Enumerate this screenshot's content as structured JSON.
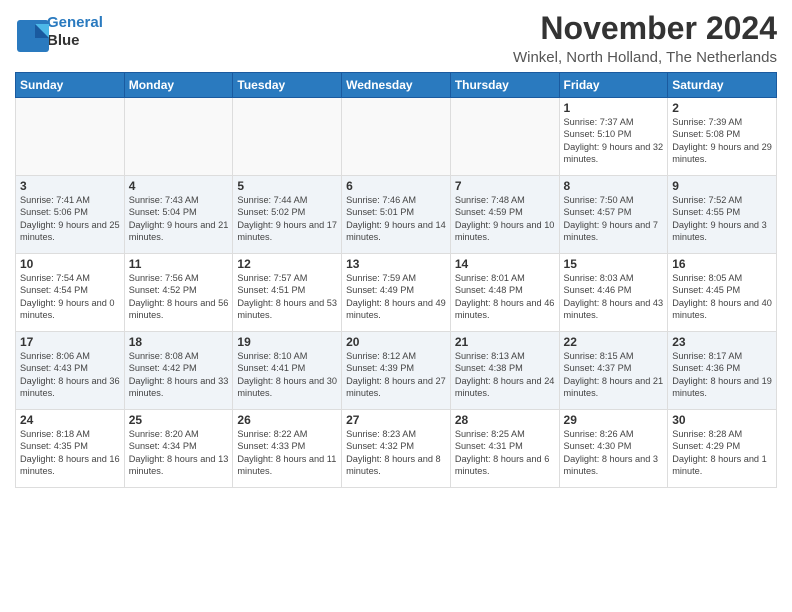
{
  "logo": {
    "line1": "General",
    "line2": "Blue"
  },
  "title": "November 2024",
  "location": "Winkel, North Holland, The Netherlands",
  "weekdays": [
    "Sunday",
    "Monday",
    "Tuesday",
    "Wednesday",
    "Thursday",
    "Friday",
    "Saturday"
  ],
  "weeks": [
    [
      {
        "day": "",
        "info": ""
      },
      {
        "day": "",
        "info": ""
      },
      {
        "day": "",
        "info": ""
      },
      {
        "day": "",
        "info": ""
      },
      {
        "day": "",
        "info": ""
      },
      {
        "day": "1",
        "info": "Sunrise: 7:37 AM\nSunset: 5:10 PM\nDaylight: 9 hours and 32 minutes."
      },
      {
        "day": "2",
        "info": "Sunrise: 7:39 AM\nSunset: 5:08 PM\nDaylight: 9 hours and 29 minutes."
      }
    ],
    [
      {
        "day": "3",
        "info": "Sunrise: 7:41 AM\nSunset: 5:06 PM\nDaylight: 9 hours and 25 minutes."
      },
      {
        "day": "4",
        "info": "Sunrise: 7:43 AM\nSunset: 5:04 PM\nDaylight: 9 hours and 21 minutes."
      },
      {
        "day": "5",
        "info": "Sunrise: 7:44 AM\nSunset: 5:02 PM\nDaylight: 9 hours and 17 minutes."
      },
      {
        "day": "6",
        "info": "Sunrise: 7:46 AM\nSunset: 5:01 PM\nDaylight: 9 hours and 14 minutes."
      },
      {
        "day": "7",
        "info": "Sunrise: 7:48 AM\nSunset: 4:59 PM\nDaylight: 9 hours and 10 minutes."
      },
      {
        "day": "8",
        "info": "Sunrise: 7:50 AM\nSunset: 4:57 PM\nDaylight: 9 hours and 7 minutes."
      },
      {
        "day": "9",
        "info": "Sunrise: 7:52 AM\nSunset: 4:55 PM\nDaylight: 9 hours and 3 minutes."
      }
    ],
    [
      {
        "day": "10",
        "info": "Sunrise: 7:54 AM\nSunset: 4:54 PM\nDaylight: 9 hours and 0 minutes."
      },
      {
        "day": "11",
        "info": "Sunrise: 7:56 AM\nSunset: 4:52 PM\nDaylight: 8 hours and 56 minutes."
      },
      {
        "day": "12",
        "info": "Sunrise: 7:57 AM\nSunset: 4:51 PM\nDaylight: 8 hours and 53 minutes."
      },
      {
        "day": "13",
        "info": "Sunrise: 7:59 AM\nSunset: 4:49 PM\nDaylight: 8 hours and 49 minutes."
      },
      {
        "day": "14",
        "info": "Sunrise: 8:01 AM\nSunset: 4:48 PM\nDaylight: 8 hours and 46 minutes."
      },
      {
        "day": "15",
        "info": "Sunrise: 8:03 AM\nSunset: 4:46 PM\nDaylight: 8 hours and 43 minutes."
      },
      {
        "day": "16",
        "info": "Sunrise: 8:05 AM\nSunset: 4:45 PM\nDaylight: 8 hours and 40 minutes."
      }
    ],
    [
      {
        "day": "17",
        "info": "Sunrise: 8:06 AM\nSunset: 4:43 PM\nDaylight: 8 hours and 36 minutes."
      },
      {
        "day": "18",
        "info": "Sunrise: 8:08 AM\nSunset: 4:42 PM\nDaylight: 8 hours and 33 minutes."
      },
      {
        "day": "19",
        "info": "Sunrise: 8:10 AM\nSunset: 4:41 PM\nDaylight: 8 hours and 30 minutes."
      },
      {
        "day": "20",
        "info": "Sunrise: 8:12 AM\nSunset: 4:39 PM\nDaylight: 8 hours and 27 minutes."
      },
      {
        "day": "21",
        "info": "Sunrise: 8:13 AM\nSunset: 4:38 PM\nDaylight: 8 hours and 24 minutes."
      },
      {
        "day": "22",
        "info": "Sunrise: 8:15 AM\nSunset: 4:37 PM\nDaylight: 8 hours and 21 minutes."
      },
      {
        "day": "23",
        "info": "Sunrise: 8:17 AM\nSunset: 4:36 PM\nDaylight: 8 hours and 19 minutes."
      }
    ],
    [
      {
        "day": "24",
        "info": "Sunrise: 8:18 AM\nSunset: 4:35 PM\nDaylight: 8 hours and 16 minutes."
      },
      {
        "day": "25",
        "info": "Sunrise: 8:20 AM\nSunset: 4:34 PM\nDaylight: 8 hours and 13 minutes."
      },
      {
        "day": "26",
        "info": "Sunrise: 8:22 AM\nSunset: 4:33 PM\nDaylight: 8 hours and 11 minutes."
      },
      {
        "day": "27",
        "info": "Sunrise: 8:23 AM\nSunset: 4:32 PM\nDaylight: 8 hours and 8 minutes."
      },
      {
        "day": "28",
        "info": "Sunrise: 8:25 AM\nSunset: 4:31 PM\nDaylight: 8 hours and 6 minutes."
      },
      {
        "day": "29",
        "info": "Sunrise: 8:26 AM\nSunset: 4:30 PM\nDaylight: 8 hours and 3 minutes."
      },
      {
        "day": "30",
        "info": "Sunrise: 8:28 AM\nSunset: 4:29 PM\nDaylight: 8 hours and 1 minute."
      }
    ]
  ]
}
